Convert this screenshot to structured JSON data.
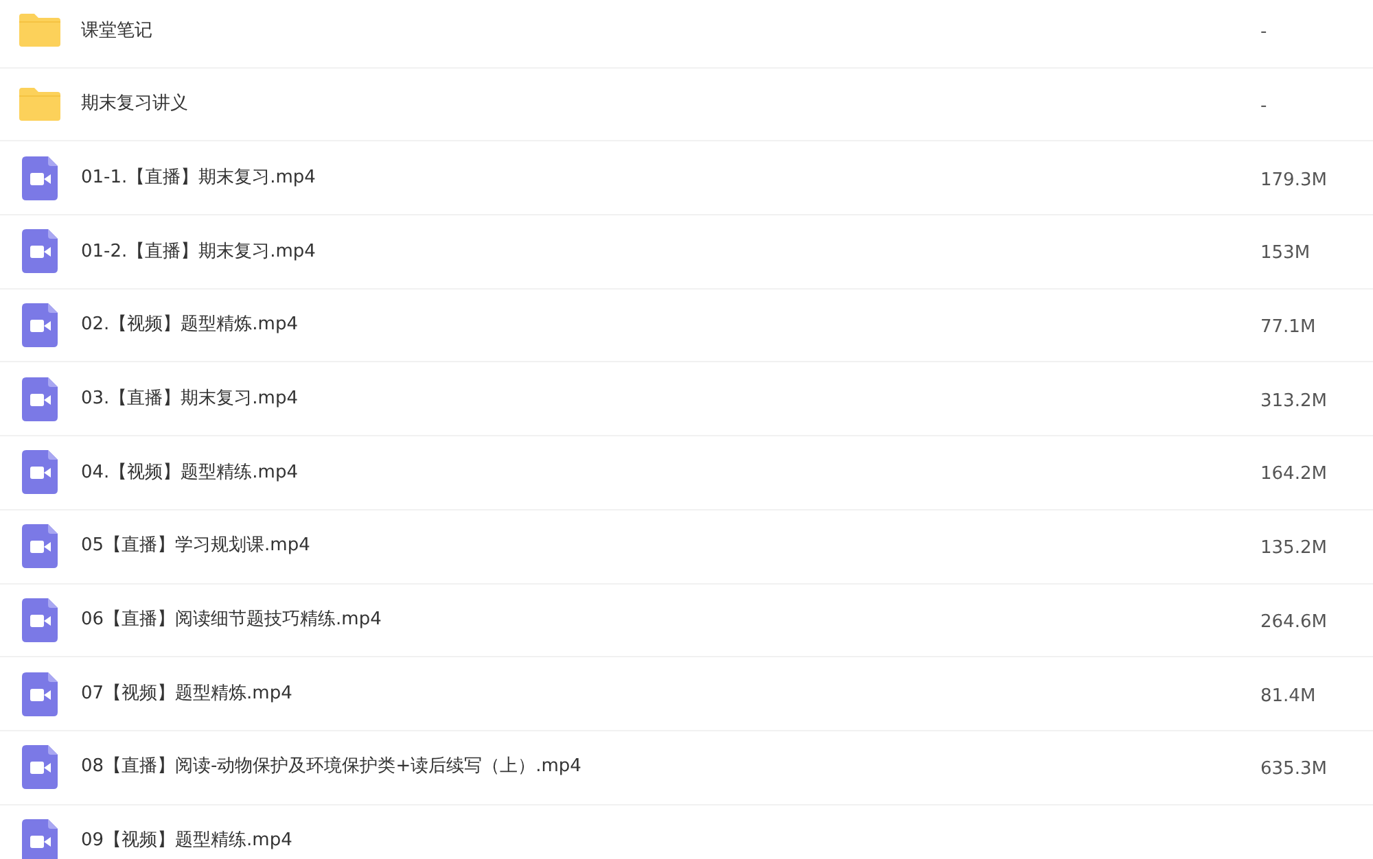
{
  "files": [
    {
      "kind": "folder",
      "name": "课堂笔记",
      "size": "-"
    },
    {
      "kind": "folder",
      "name": "期末复习讲义",
      "size": "-"
    },
    {
      "kind": "video",
      "name": "01-1.【直播】期末复习.mp4",
      "size": "179.3M"
    },
    {
      "kind": "video",
      "name": "01-2.【直播】期末复习.mp4",
      "size": "153M"
    },
    {
      "kind": "video",
      "name": "02.【视频】题型精炼.mp4",
      "size": "77.1M"
    },
    {
      "kind": "video",
      "name": "03.【直播】期末复习.mp4",
      "size": "313.2M"
    },
    {
      "kind": "video",
      "name": "04.【视频】题型精练.mp4",
      "size": "164.2M"
    },
    {
      "kind": "video",
      "name": "05【直播】学习规划课.mp4",
      "size": "135.2M"
    },
    {
      "kind": "video",
      "name": "06【直播】阅读细节题技巧精练.mp4",
      "size": "264.6M"
    },
    {
      "kind": "video",
      "name": "07【视频】题型精炼.mp4",
      "size": "81.4M"
    },
    {
      "kind": "video",
      "name": "08【直播】阅读-动物保护及环境保护类+读后续写（上）.mp4",
      "size": "635.3M"
    },
    {
      "kind": "video",
      "name": "09【视频】题型精练.mp4"
    }
  ]
}
